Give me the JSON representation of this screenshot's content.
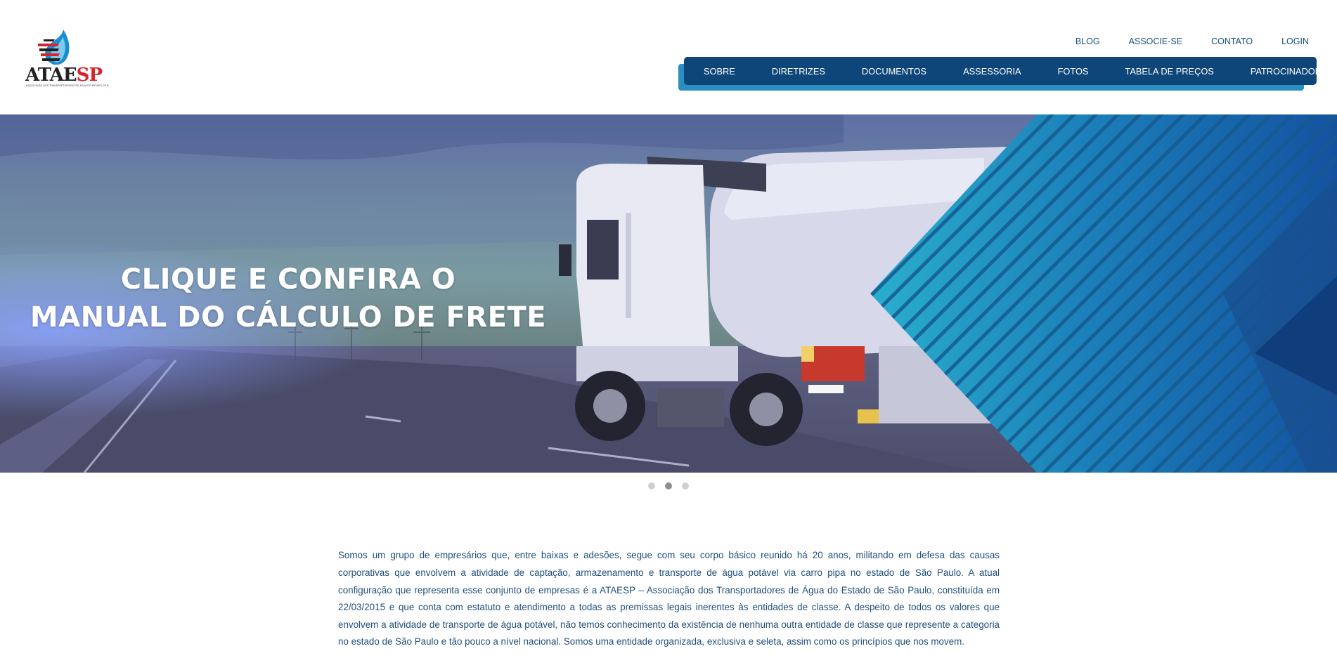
{
  "brand": {
    "logo_text_main": "ATAE",
    "logo_text_accent": "SP",
    "logo_tagline": "ASSOCIAÇÃO DOS TRANSPORTADORES DE ÁGUA DO ESTADO DE SÃO PAULO"
  },
  "top_links": [
    "BLOG",
    "ASSOCIE-SE",
    "CONTATO",
    "LOGIN"
  ],
  "nav": [
    "SOBRE",
    "DIRETRIZES",
    "DOCUMENTOS",
    "ASSESSORIA",
    "FOTOS",
    "TABELA DE PREÇOS",
    "PATROCINADORES"
  ],
  "hero": {
    "title_line1": "CLIQUE E CONFIRA O",
    "title_line2": "MANUAL DO CÁLCULO DE FRETE"
  },
  "slider": {
    "count": 3,
    "active_index": 1
  },
  "intro": "Somos um grupo de empresários que, entre baixas e adesões, segue com seu corpo básico reunido há 20 anos, militando em defesa das causas corporativas que envolvem a atividade de captação, armazenamento e transporte de água potável via carro pipa no estado de São Paulo. A atual configuração que representa esse conjunto de empresas é a ATAESP – Associação dos Transportadores de Água do Estado de São Paulo, constituída em 22/03/2015  e que conta com estatuto e atendimento a todas as premissas legais inerentes às entidades de classe. A despeito de todos os valores que envolvem a atividade de transporte de água potável, não temos conhecimento da existência de nenhuma outra entidade de classe que represente a categoria no estado de São Paulo e tão pouco a nível nacional. Somos uma entidade organizada, exclusiva e seleta, assim como os princípios que nos movem.",
  "colors": {
    "nav_bg": "#0f4679",
    "nav_accent": "#2a8fc0",
    "link": "#1b4f7e",
    "text": "#1f4e7a",
    "brand_red": "#d9232d"
  }
}
